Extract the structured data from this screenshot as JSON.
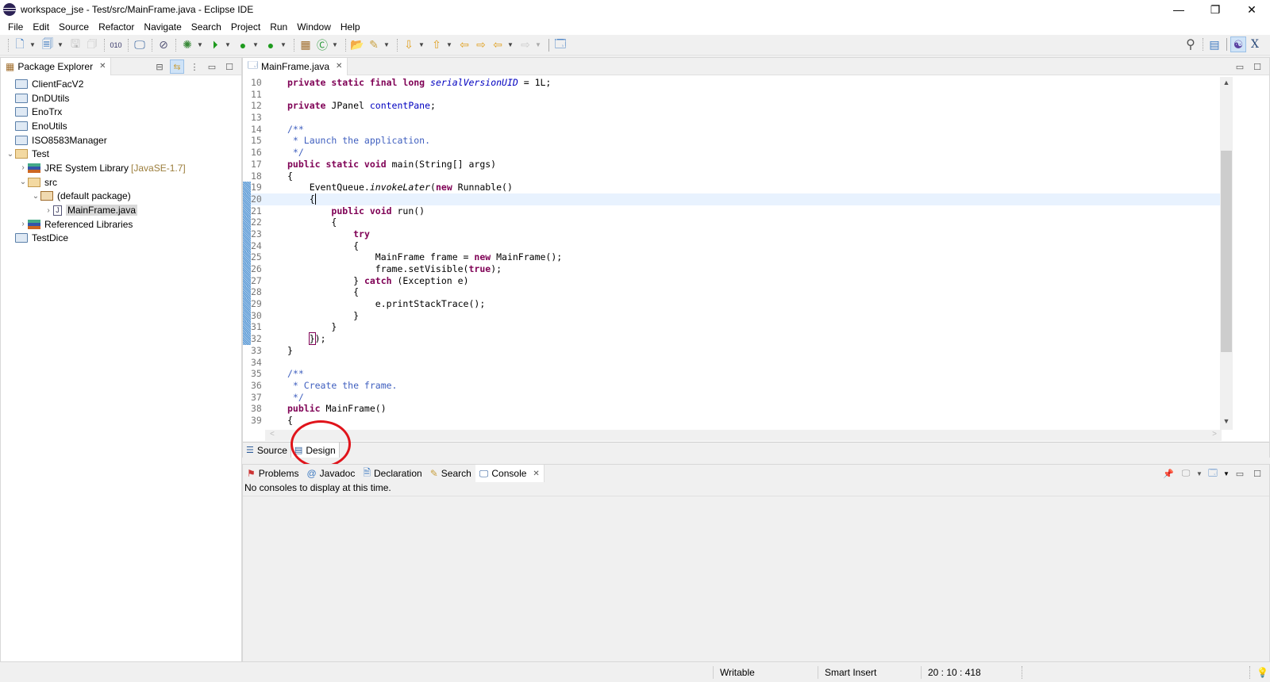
{
  "window": {
    "title": "workspace_jse - Test/src/MainFrame.java - Eclipse IDE",
    "controls": {
      "minimize": "—",
      "restore": "❐",
      "close": "✕"
    }
  },
  "menu": [
    "File",
    "Edit",
    "Source",
    "Refactor",
    "Navigate",
    "Search",
    "Project",
    "Run",
    "Window",
    "Help"
  ],
  "toolbar": {
    "icons": [
      "new-icon",
      "new-package-icon",
      "save-icon",
      "save-all-icon",
      "binary-icon",
      "terminal-icon",
      "skip-breakpoints-icon",
      "debug-icon",
      "run-icon",
      "coverage-icon",
      "external-tools-icon",
      "new-java-package-icon",
      "new-java-class-icon",
      "open-type-icon",
      "search-icon",
      "next-annotation-icon",
      "previous-annotation-icon",
      "last-edit-icon",
      "next-edit-icon",
      "back-icon",
      "forward-icon",
      "pin-editor-icon"
    ],
    "right_icons": [
      "search-icon",
      "open-perspective-icon",
      "java-perspective-icon",
      "xml-perspective-icon"
    ]
  },
  "package_explorer": {
    "tab_label": "Package Explorer",
    "tree": [
      {
        "label": "ClientFacV2",
        "level": 0,
        "type": "project",
        "expander": ""
      },
      {
        "label": "DnDUtils",
        "level": 0,
        "type": "project",
        "expander": ""
      },
      {
        "label": "EnoTrx",
        "level": 0,
        "type": "project",
        "expander": ""
      },
      {
        "label": "EnoUtils",
        "level": 0,
        "type": "project",
        "expander": ""
      },
      {
        "label": "ISO8583Manager",
        "level": 0,
        "type": "project",
        "expander": ""
      },
      {
        "label": "Test",
        "level": 0,
        "type": "open-project",
        "expander": "expanded"
      },
      {
        "label": "JRE System Library",
        "decoration": "[JavaSE-1.7]",
        "level": 1,
        "type": "library",
        "expander": "collapsed"
      },
      {
        "label": "src",
        "level": 1,
        "type": "source-folder",
        "expander": "expanded"
      },
      {
        "label": "(default package)",
        "level": 2,
        "type": "package",
        "expander": "expanded"
      },
      {
        "label": "MainFrame.java",
        "level": 3,
        "type": "java-file",
        "expander": "collapsed",
        "selected": true
      },
      {
        "label": "Referenced Libraries",
        "level": 1,
        "type": "library",
        "expander": "collapsed"
      },
      {
        "label": "TestDice",
        "level": 0,
        "type": "project",
        "expander": ""
      }
    ]
  },
  "editor": {
    "tab_label": "MainFrame.java",
    "current_line": 20,
    "lines": [
      {
        "n": "10",
        "html": "<span class='kw'>private static final long</span> <span class='sfld'>serialVersionUID</span> = 1L;"
      },
      {
        "n": "11",
        "html": ""
      },
      {
        "n": "12",
        "html": "<span class='kw'>private</span> JPanel <span class='fld'>contentPane</span>;"
      },
      {
        "n": "13",
        "html": ""
      },
      {
        "n": "14",
        "html": "<span class='cm'>/**</span>"
      },
      {
        "n": "15",
        "html": "<span class='cm'> * Launch the application.</span>"
      },
      {
        "n": "16",
        "html": "<span class='cm'> */</span>"
      },
      {
        "n": "17",
        "html": "<span class='kw'>public static void</span> main(String[] args)"
      },
      {
        "n": "18",
        "html": "{"
      },
      {
        "n": "19",
        "html": "    EventQueue.<span class='it'>invokeLater</span>(<span class='kw'>new</span> Runnable()",
        "mark": true
      },
      {
        "n": "20",
        "html": "    {<span class='cursor'></span>",
        "mark": true
      },
      {
        "n": "21",
        "html": "        <span class='kw'>public void</span> run()",
        "mark": true
      },
      {
        "n": "22",
        "html": "        {",
        "mark": true
      },
      {
        "n": "23",
        "html": "            <span class='kw'>try</span>",
        "mark": true
      },
      {
        "n": "24",
        "html": "            {",
        "mark": true
      },
      {
        "n": "25",
        "html": "                MainFrame frame = <span class='kw'>new</span> MainFrame();",
        "mark": true
      },
      {
        "n": "26",
        "html": "                frame.setVisible(<span class='kw'>true</span>);",
        "mark": true
      },
      {
        "n": "27",
        "html": "            } <span class='kw'>catch</span> (Exception e)",
        "mark": true
      },
      {
        "n": "28",
        "html": "            {",
        "mark": true
      },
      {
        "n": "29",
        "html": "                e.printStackTrace();",
        "mark": true
      },
      {
        "n": "30",
        "html": "            }",
        "mark": true
      },
      {
        "n": "31",
        "html": "        }",
        "mark": true
      },
      {
        "n": "32",
        "html": "    <span class='brk'>}</span>);",
        "mark": true
      },
      {
        "n": "33",
        "html": "}"
      },
      {
        "n": "34",
        "html": ""
      },
      {
        "n": "35",
        "html": "<span class='cm'>/**</span>"
      },
      {
        "n": "36",
        "html": "<span class='cm'> * Create the frame.</span>"
      },
      {
        "n": "37",
        "html": "<span class='cm'> */</span>"
      },
      {
        "n": "38",
        "html": "<span class='kw'>public</span> MainFrame()"
      },
      {
        "n": "39",
        "html": "{"
      }
    ],
    "bottom_tabs": [
      {
        "label": "Source",
        "icon": "source-icon"
      },
      {
        "label": "Design",
        "icon": "design-icon",
        "active": true
      }
    ]
  },
  "bottom_panel": {
    "tabs": [
      {
        "label": "Problems",
        "icon": "problems-icon"
      },
      {
        "label": "Javadoc",
        "icon": "javadoc-icon"
      },
      {
        "label": "Declaration",
        "icon": "declaration-icon"
      },
      {
        "label": "Search",
        "icon": "search-icon"
      },
      {
        "label": "Console",
        "icon": "console-icon",
        "active": true
      }
    ],
    "console_message": "No consoles to display at this time."
  },
  "status_bar": {
    "writable": "Writable",
    "insert_mode": "Smart Insert",
    "position": "20 : 10 : 418"
  },
  "annotation": {
    "color": "#e0141b",
    "target": "Design tab"
  }
}
